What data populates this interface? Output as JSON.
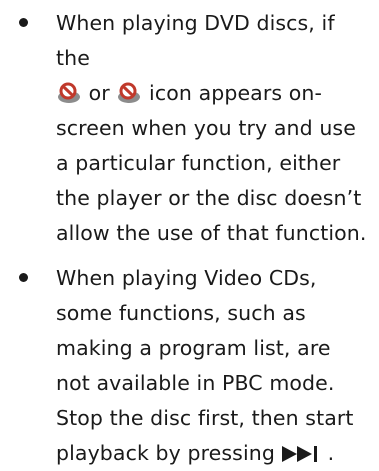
{
  "items": [
    {
      "line1": "When playing DVD discs, if the",
      "or": "or",
      "rest_line2": "icon appears on-",
      "rest": "screen when you try and use a particular function, either the player or the disc doesn’t allow the use of that function.",
      "icons": [
        "prohibited-disc-icon",
        "prohibited-disc-icon"
      ]
    },
    {
      "text": "When playing Video CDs, some functions, such as making a program list, are not available in PBC mode. Stop the disc first, then start playback by pressing",
      "end": ".",
      "icon": "play-skip-icon"
    }
  ],
  "colors": {
    "text": "#1a1a1a",
    "disc_gray": "#8c8c8c",
    "prohibit_red": "#c0392b"
  }
}
